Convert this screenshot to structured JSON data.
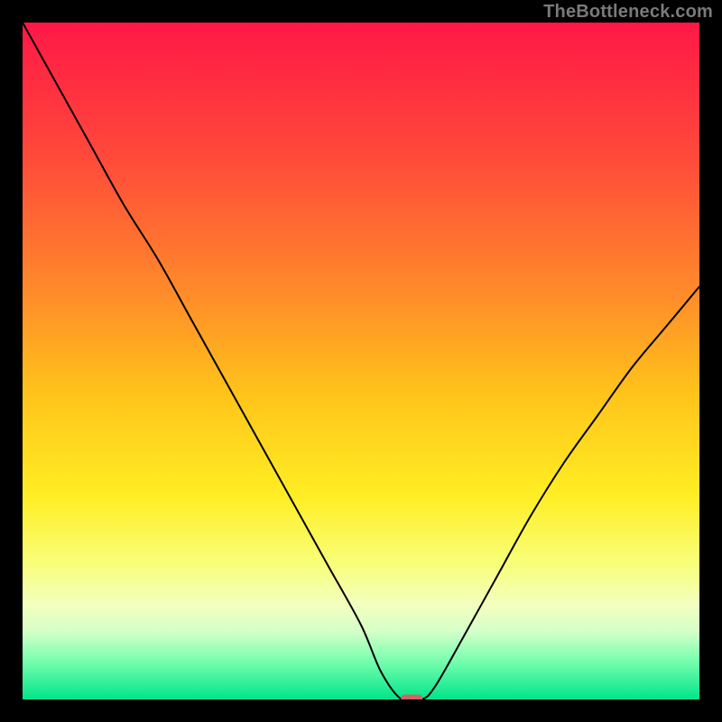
{
  "watermark": "TheBottleneck.com",
  "chart_data": {
    "type": "line",
    "title": "",
    "xlabel": "",
    "ylabel": "",
    "xlim": [
      0,
      100
    ],
    "ylim": [
      0,
      100
    ],
    "grid": false,
    "background_gradient": {
      "stops": [
        {
          "offset": 0,
          "color": "#ff1846"
        },
        {
          "offset": 20,
          "color": "#ff4a3a"
        },
        {
          "offset": 40,
          "color": "#ff8b2a"
        },
        {
          "offset": 55,
          "color": "#ffc41a"
        },
        {
          "offset": 70,
          "color": "#ffee24"
        },
        {
          "offset": 80,
          "color": "#f8ff7a"
        },
        {
          "offset": 86,
          "color": "#f3ffbf"
        },
        {
          "offset": 90,
          "color": "#d4ffc8"
        },
        {
          "offset": 94,
          "color": "#7dffb0"
        },
        {
          "offset": 100,
          "color": "#00e58a"
        }
      ]
    },
    "series": [
      {
        "name": "bottleneck-curve",
        "color": "#000000",
        "x": [
          0,
          5,
          10,
          15,
          20,
          25,
          30,
          35,
          40,
          45,
          50,
          53,
          56,
          59,
          61,
          65,
          70,
          75,
          80,
          85,
          90,
          95,
          100
        ],
        "y": [
          100,
          91,
          82,
          73,
          65,
          56,
          47,
          38,
          29,
          20,
          11,
          4,
          0,
          0,
          2,
          9,
          18,
          27,
          35,
          42,
          49,
          55,
          61
        ]
      }
    ],
    "marker": {
      "name": "optimal-point",
      "x": 57.5,
      "y": 0,
      "width_pct": 3.2,
      "height_pct": 1.2,
      "fill": "#d4625f"
    }
  }
}
